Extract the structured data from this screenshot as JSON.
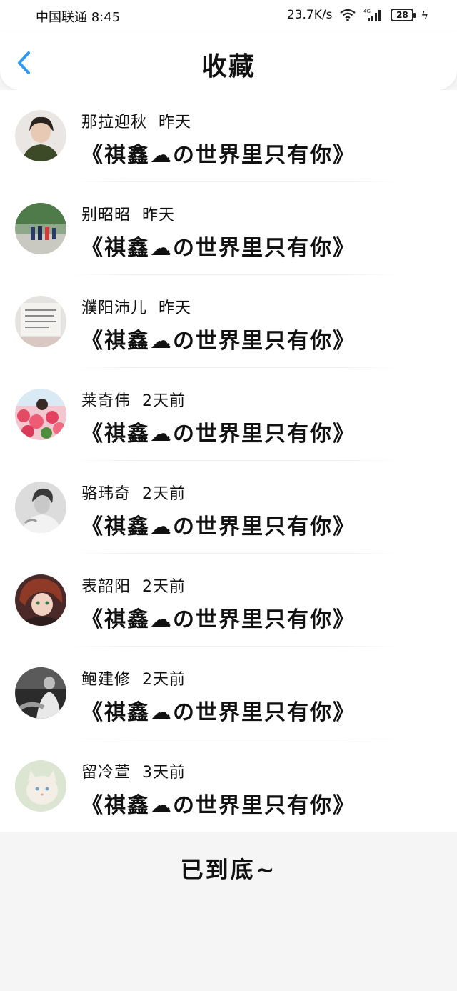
{
  "status_bar": {
    "carrier_time": "中国联通 8:45",
    "network_speed": "23.7K/s",
    "network_type": "4G",
    "battery": "28"
  },
  "header": {
    "title": "收藏",
    "back_icon": "chevron-left-icon",
    "accent_color": "#2f9bf0"
  },
  "favorites": [
    {
      "user": "那拉迎秋",
      "time": "昨天",
      "song": "《祺鑫☁の世界里只有你》"
    },
    {
      "user": "别昭昭",
      "time": "昨天",
      "song": "《祺鑫☁の世界里只有你》"
    },
    {
      "user": "濮阳沛儿",
      "time": "昨天",
      "song": "《祺鑫☁の世界里只有你》"
    },
    {
      "user": "莱奇伟",
      "time": "2天前",
      "song": "《祺鑫☁の世界里只有你》"
    },
    {
      "user": "骆玮奇",
      "time": "2天前",
      "song": "《祺鑫☁の世界里只有你》"
    },
    {
      "user": "表韶阳",
      "time": "2天前",
      "song": "《祺鑫☁の世界里只有你》"
    },
    {
      "user": "鲍建修",
      "time": "2天前",
      "song": "《祺鑫☁の世界里只有你》"
    },
    {
      "user": "留冷萱",
      "time": "3天前",
      "song": "《祺鑫☁の世界里只有你》"
    }
  ],
  "footer": {
    "end_text": "已到底~"
  }
}
